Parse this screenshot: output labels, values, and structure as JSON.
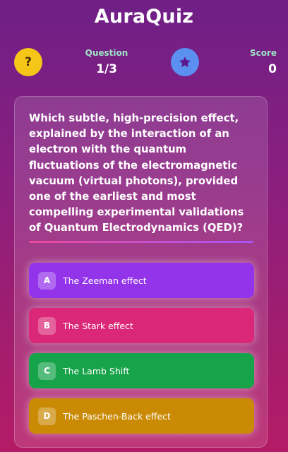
{
  "header": {
    "title": "AuraQuiz",
    "help_symbol": "?",
    "help_icon": "question-icon",
    "star_icon": "star-icon"
  },
  "stats": {
    "question_label": "Question",
    "question_value": "1/3",
    "score_label": "Score",
    "score_value": "0"
  },
  "quiz": {
    "question": "Which subtle, high-precision effect, explained by the interaction of an electron with the quantum fluctuations of the electromagnetic vacuum (virtual photons), provided one of the earliest and most compelling experimental validations of Quantum Electrodynamics (QED)?",
    "options": [
      {
        "letter": "A",
        "text": "The Zeeman effect",
        "color": "#9333ea"
      },
      {
        "letter": "B",
        "text": "The Stark effect",
        "color": "#db2777"
      },
      {
        "letter": "C",
        "text": "The Lamb Shift",
        "color": "#16a34a"
      },
      {
        "letter": "D",
        "text": "The Paschen-Back effect",
        "color": "#ca8a04"
      }
    ]
  },
  "colors": {
    "help_button": "#f5c518",
    "star_button": "#5b8ff0",
    "stat_label": "#9fe3c6"
  }
}
